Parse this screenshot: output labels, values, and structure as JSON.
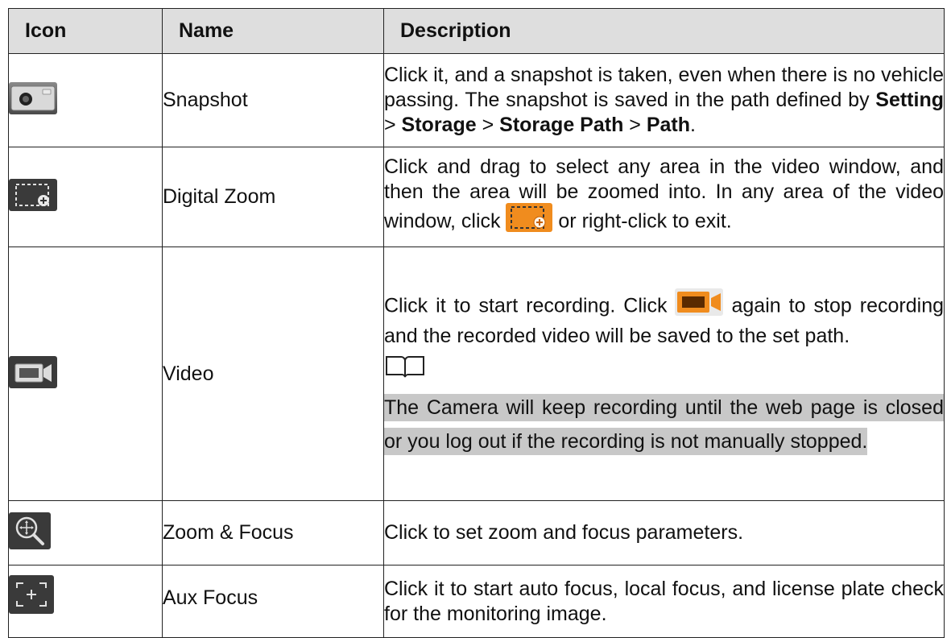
{
  "table": {
    "headers": {
      "icon": "Icon",
      "name": "Name",
      "description": "Description"
    },
    "rows": [
      {
        "icon": "snapshot-camera-icon",
        "name": "Snapshot",
        "desc": {
          "text1": "Click it, and a snapshot is taken, even when there is no vehicle passing. The snapshot is saved in the path defined by ",
          "path1": "Setting",
          "sep1": " > ",
          "path2": "Storage",
          "sep2": " > ",
          "path3": "Storage Path",
          "sep3": " > ",
          "path4": "Path",
          "end": "."
        }
      },
      {
        "icon": "digital-zoom-icon",
        "name": "Digital Zoom",
        "desc": {
          "text1": "Click and drag to select any area in the video window, and then the area will be zoomed into. In any area of the video window, click ",
          "text2": " or right-click to exit."
        }
      },
      {
        "icon": "video-record-icon",
        "name": "Video",
        "desc": {
          "text1": "Click it to start recording. Click ",
          "text2": " again to stop recording and the recorded video will be saved to the set path.",
          "note": "The Camera will keep recording until the web page is closed or you log out if the recording is not manually stopped."
        }
      },
      {
        "icon": "zoom-focus-icon",
        "name": "Zoom & Focus",
        "desc": {
          "text1": "Click to set zoom and focus parameters."
        }
      },
      {
        "icon": "aux-focus-icon",
        "name": "Aux Focus",
        "desc": {
          "text1": "Click it to start auto focus, local focus, and license plate check for the monitoring image."
        }
      }
    ]
  },
  "colors": {
    "header_bg": "#dedede",
    "highlight": "#c8c8c8",
    "accent_orange": "#f08c1e",
    "icon_dark": "#3a3a3a"
  }
}
